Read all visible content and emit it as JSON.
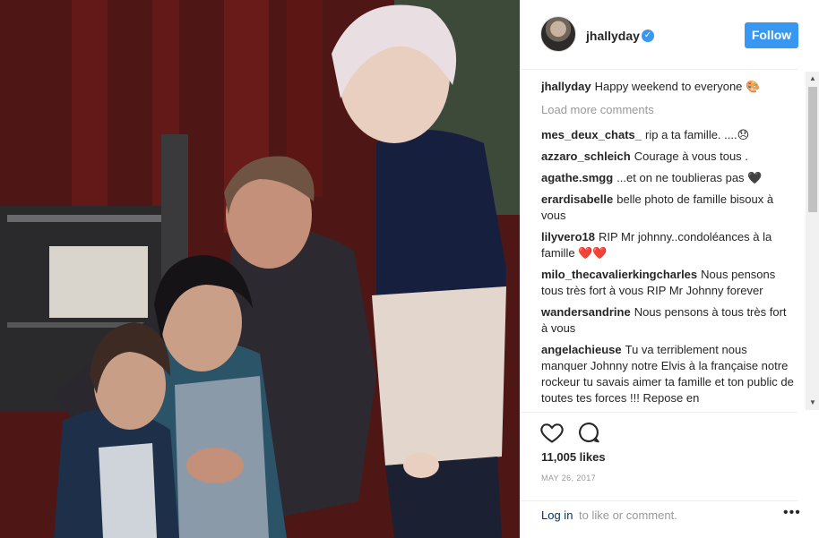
{
  "post": {
    "username": "jhallyday",
    "verified_mark": "✓",
    "follow_label": "Follow",
    "likes_text": "11,005 likes",
    "date_text": "MAY 26, 2017",
    "login_link": "Log in",
    "login_suffix": "to like or comment.",
    "more_glyph": "•••"
  },
  "caption": {
    "user": "jhallyday",
    "text": "Happy weekend to everyone",
    "emoji": "🎨"
  },
  "load_more_label": "Load more comments",
  "comments": [
    {
      "user": "mes_deux_chats_",
      "text": "rip a ta famille. ....",
      "emoji": "😞"
    },
    {
      "user": "azzaro_schleich",
      "text": "Courage à vous tous ."
    },
    {
      "user": "agathe.smgg",
      "text": "...et on ne toublieras pas",
      "emoji": "🖤"
    },
    {
      "user": "erardisabelle",
      "text": "belle photo de famille bisoux à vous"
    },
    {
      "user": "lilyvero18",
      "text": "RIP Mr johnny..condoléances à la famille",
      "emoji": "❤️❤️"
    },
    {
      "user": "milo_thecavalierkingcharles",
      "text": "Nous pensons tous très fort à vous RIP Mr Johnny forever"
    },
    {
      "user": "wandersandrine",
      "text": "Nous pensons à tous très fort à vous"
    },
    {
      "user": "angelachieuse",
      "text": "Tu va terriblement nous manquer Johnny notre Elvis à la française notre rockeur tu savais aimer ta famille et ton public de toutes tes forces !!! Repose en"
    }
  ],
  "icons": {
    "like": "heart-outline-icon",
    "comment": "speech-bubble-icon",
    "verified": "verified-badge-icon",
    "more": "more-options-icon"
  },
  "colors": {
    "accent": "#3897f0",
    "text": "#262626",
    "muted": "#999999",
    "link": "#003569",
    "divider": "#efefef"
  }
}
